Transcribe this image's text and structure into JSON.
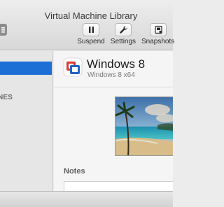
{
  "window": {
    "title": "Virtual Machine Library"
  },
  "toolbar": {
    "suspend_label": "Suspend",
    "settings_label": "Settings",
    "snapshots_label": "Snapshots"
  },
  "sidebar": {
    "section_label": "NES"
  },
  "vm": {
    "name": "Windows 8",
    "subtitle": "Windows 8 x64"
  },
  "notes": {
    "label": "Notes",
    "value": ""
  },
  "colors": {
    "selection": "#1d6fd6",
    "vm_icon_red": "#d93a2f",
    "vm_icon_blue": "#2364c5"
  },
  "icons": [
    "sidebar-toggle-icon",
    "pause-icon",
    "wrench-icon",
    "snapshot-icon",
    "vmware-fusion-icon"
  ]
}
